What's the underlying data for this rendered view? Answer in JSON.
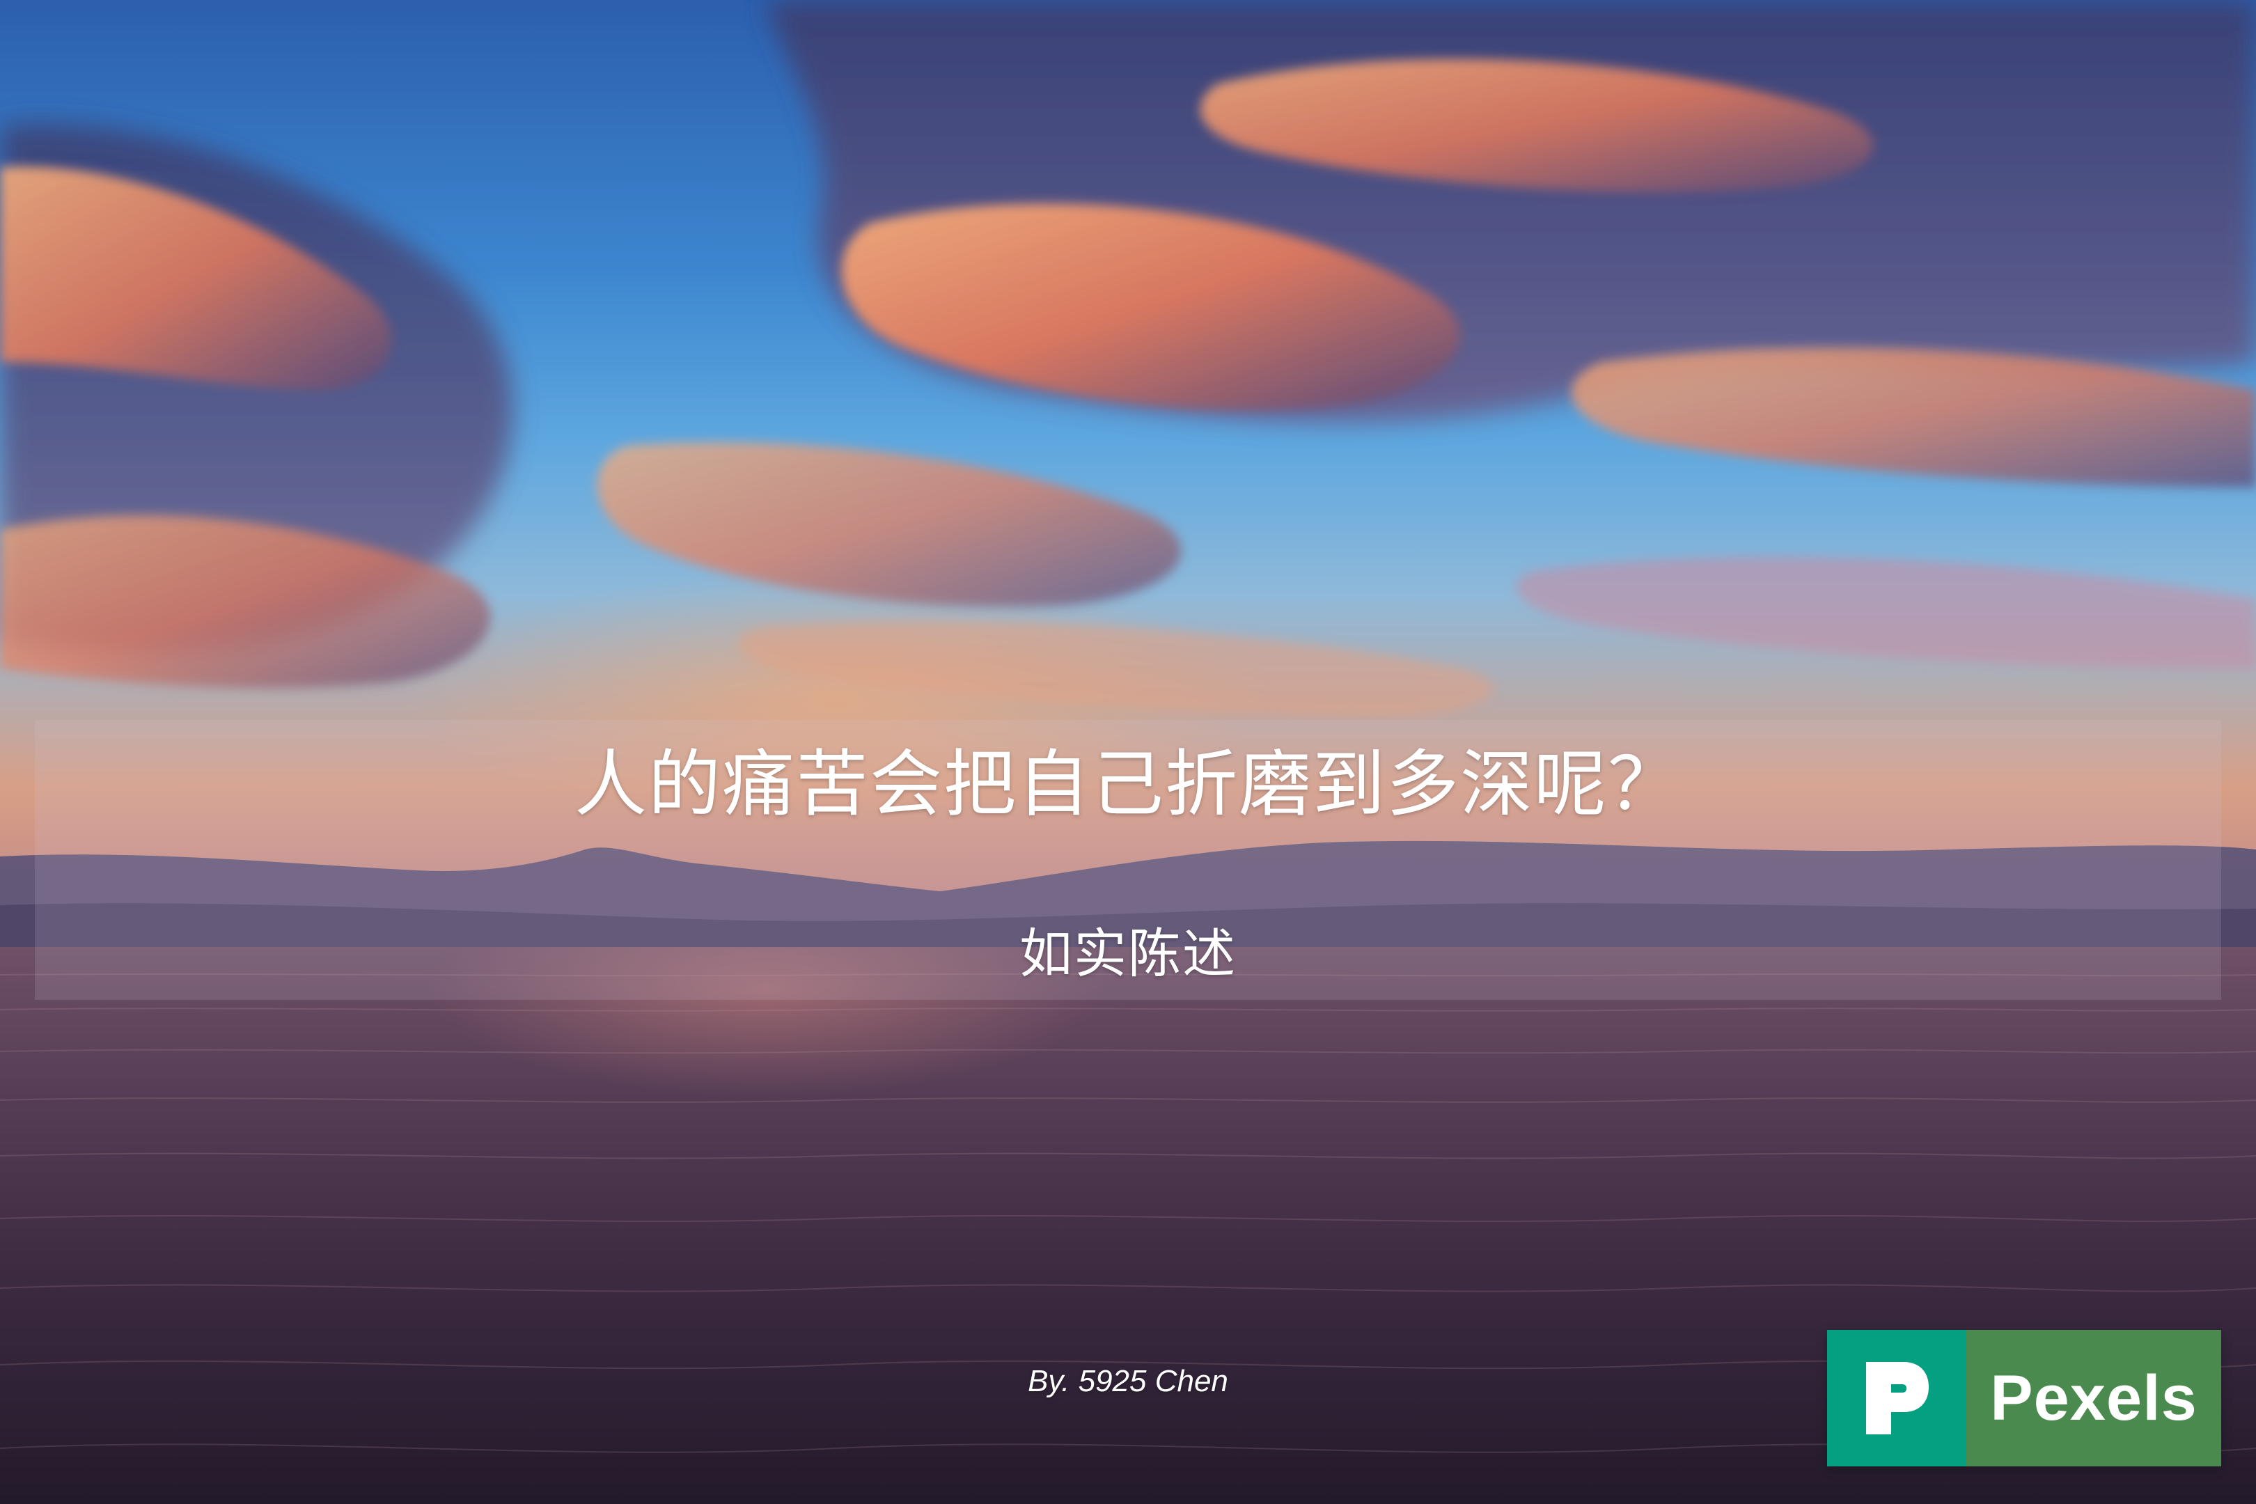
{
  "cover": {
    "title": "人的痛苦会把自己折磨到多深呢？",
    "subtitle": "如实陈述",
    "byline": "By. 5925 Chen"
  },
  "watermark": {
    "brand": "Pexels",
    "icon": "pexels-p-icon",
    "icon_color": "#05a081",
    "label_color": "#4a8a4f"
  },
  "scene": {
    "description_colors": {
      "sky_top": "#2c5fae",
      "cloud_glow": "#f5a070",
      "sea": "#3f2c43"
    }
  }
}
